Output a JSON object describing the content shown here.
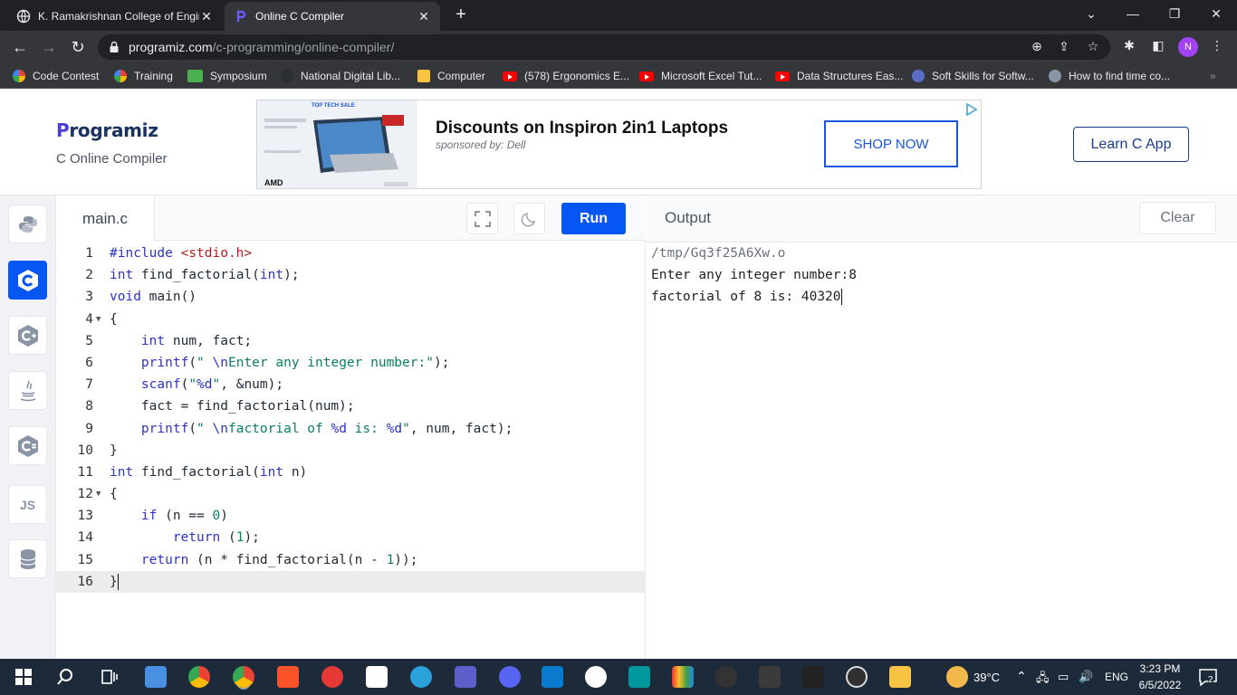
{
  "browser": {
    "tabs": [
      {
        "title": "K. Ramakrishnan College of Engir"
      },
      {
        "title": "Online C Compiler"
      }
    ],
    "url_host": "programiz.com",
    "url_path": "/c-programming/online-compiler/",
    "profile_initial": "N"
  },
  "bookmarks": [
    "Code Contest",
    "Training",
    "Symposium",
    "National Digital Lib...",
    "Computer",
    "(578) Ergonomics E...",
    "Microsoft Excel Tut...",
    "Data Structures Eas...",
    "Soft Skills for Softw...",
    "How to find time co..."
  ],
  "header": {
    "logo_text": "rogramiz",
    "logo_initial": "P",
    "subtitle": "C Online Compiler",
    "learn_app": "Learn C App"
  },
  "ad": {
    "title": "Discounts on Inspiron 2in1 Laptops",
    "sponsor": "sponsored by: Dell",
    "cta": "SHOP NOW",
    "banner_top": "TOP TECH SALE",
    "banner_brand": "AMD"
  },
  "languages": [
    "python-icon",
    "c-icon",
    "cpp-icon",
    "java-icon",
    "csharp-icon",
    "JS",
    "sql-icon"
  ],
  "editor": {
    "filename": "main.c",
    "run_label": "Run",
    "lines": [
      {
        "n": "1"
      },
      {
        "n": "2"
      },
      {
        "n": "3"
      },
      {
        "n": "4"
      },
      {
        "n": "5"
      },
      {
        "n": "6"
      },
      {
        "n": "7"
      },
      {
        "n": "8"
      },
      {
        "n": "9"
      },
      {
        "n": "10"
      },
      {
        "n": "11"
      },
      {
        "n": "12"
      },
      {
        "n": "13"
      },
      {
        "n": "14"
      },
      {
        "n": "15"
      },
      {
        "n": "16"
      }
    ]
  },
  "output": {
    "label": "Output",
    "clear_label": "Clear",
    "lines": [
      "/tmp/Gq3f25A6Xw.o",
      "Enter any integer number:8",
      "factorial of 8 is: 40320"
    ]
  },
  "taskbar": {
    "weather": "39°C",
    "lang": "ENG",
    "time": "3:23 PM",
    "date": "6/5/2022",
    "notifications": "2"
  },
  "colors": {
    "accent": "#0556f3",
    "keyword": "#2d33c8",
    "string": "#0a7d6a",
    "header": "#b41e1e"
  }
}
